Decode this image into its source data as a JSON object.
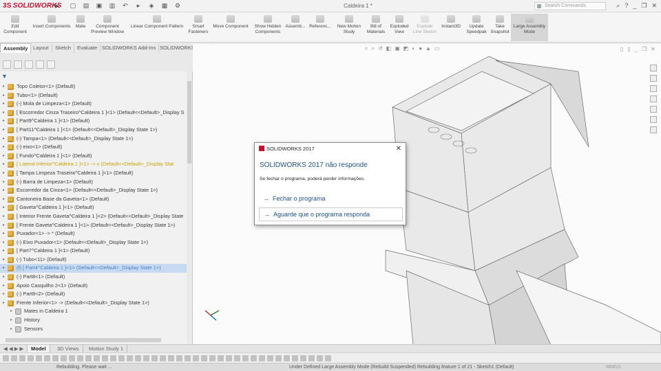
{
  "app": {
    "logo": "SOLIDWORKS",
    "window_title": "Caldeira 1 *",
    "search_placeholder": "Search Commands"
  },
  "ribbon": [
    {
      "label": "Edit\nComponent",
      "icon": "edit-component-icon"
    },
    {
      "label": "Insert Components",
      "icon": "insert-components-icon"
    },
    {
      "label": "Mate",
      "icon": "mate-icon"
    },
    {
      "label": "Component\nPreview Window",
      "icon": "preview-window-icon"
    },
    {
      "label": "Linear Component Pattern",
      "icon": "pattern-icon"
    },
    {
      "label": "Smart\nFasteners",
      "icon": "fasteners-icon"
    },
    {
      "label": "Move Component",
      "icon": "move-component-icon"
    },
    {
      "label": "Show Hidden\nComponents",
      "icon": "show-hidden-icon"
    },
    {
      "label": "Assemb...",
      "icon": "assembly-features-icon"
    },
    {
      "label": "Referenc...",
      "icon": "reference-geometry-icon"
    },
    {
      "label": "New Motion\nStudy",
      "icon": "motion-study-icon"
    },
    {
      "label": "Bill of\nMaterials",
      "icon": "bom-icon"
    },
    {
      "label": "Exploded\nView",
      "icon": "exploded-view-icon"
    },
    {
      "label": "Explode\nLine Sketch",
      "icon": "explode-line-icon"
    },
    {
      "label": "Instant3D",
      "icon": "instant3d-icon"
    },
    {
      "label": "Update\nSpeedpak",
      "icon": "speedpak-icon"
    },
    {
      "label": "Take\nSnapshot",
      "icon": "snapshot-icon"
    },
    {
      "label": "Large Assembly\nMode",
      "icon": "large-assembly-icon"
    }
  ],
  "command_tabs": [
    "Assembly",
    "Layout",
    "Sketch",
    "Evaluate",
    "SOLIDWORKS Add-Ins",
    "SOLIDWORKS MBD"
  ],
  "tree": [
    {
      "text": "Topo Coletor<1> (Default)"
    },
    {
      "text": "Tubo<1> (Default)"
    },
    {
      "text": "(-) Mola de Limpeza<1> (Default)"
    },
    {
      "text": "[ Escorredor Cinza Traseiro^Caldeira 1 ]<1> (Default<<Default>_Display S"
    },
    {
      "text": "[ Part9^Caldeira 1 ]<1> (Default)"
    },
    {
      "text": "[ Part11^Caldeira 1 ]<1> (Default<<Default>_Display State 1>)"
    },
    {
      "text": "(-) Tampa<1> (Default<<Default>_Display State 1>)"
    },
    {
      "text": "(-) eixo<1> (Default)"
    },
    {
      "text": "[ Fundo^Caldeira 1 ]<1> (Default)"
    },
    {
      "text": "[ Lateral Inferior^Caldeira 1 ]<1> -> v (Default<<Default>_Display Stat",
      "state": "warn"
    },
    {
      "text": "[ Tampa Limpeza Traseira^Caldeira 1 ]<1> (Default)"
    },
    {
      "text": "(-) Barra de Limpeza<1> (Default)"
    },
    {
      "text": "Escorredor da Cinza<1> (Default<<Default>_Display State 1>)"
    },
    {
      "text": "Cantoneira Base da Gaveta<1> (Default)"
    },
    {
      "text": "[ Gaveta^Caldeira 1 ]<1> (Default)"
    },
    {
      "text": "[ Interior Frente Gaveta^Caldeira 1 ]<2> (Default<<Default>_Display State"
    },
    {
      "text": "[ Frente Gaveta^Caldeira 1 ]<1> (Default<<Default>_Display State 1>)"
    },
    {
      "text": "Puxador<1> -> * (Default)"
    },
    {
      "text": "(-) Eixo Puxador<1> (Default<<Default>_Display State 1>)"
    },
    {
      "text": "[ Part7^Caldeira 1 ]<1> (Default)"
    },
    {
      "text": "(-) Tubo<11> (Default)"
    },
    {
      "text": "(f) [ Part4^Caldeira 1 ]<1> (Default<<Default>_Display State 1>)",
      "state": "sel"
    },
    {
      "text": "(-) Part8<1> (Default)"
    },
    {
      "text": "Apoio  Casquilho 2<1> (Default)"
    },
    {
      "text": "(-) Part8<2> (Default)"
    },
    {
      "text": "Frente Inferior<1> -> (Default<<Default>_Display State 1>)"
    },
    {
      "text": "Mates in Caldeira 1",
      "sub": true
    },
    {
      "text": "History",
      "sub": true
    },
    {
      "text": "Sensors",
      "sub": true
    }
  ],
  "dialog": {
    "caption": "SOLIDWORKS 2017",
    "title": "SOLIDWORKS 2017 não responde",
    "message": "Se fechar o programa, poderá perder informações.",
    "option_close": "Fechar o programa",
    "option_wait": "Aguarde que o programa responda"
  },
  "bottom_tabs": [
    "Model",
    "3D Views",
    "Motion Study 1"
  ],
  "status": {
    "left": "Rebuilding. Please wait ...",
    "right": "Under Defined   Large Assembly Mode (Rebuild Suspended)   Rebuilding feature 1 of 21 - Sketch1 (Default)",
    "units": "MMGS"
  },
  "colors": {
    "brand": "#c8102e",
    "link": "#1d4f8c",
    "selection": "#c7daf1",
    "warning": "#c7a300"
  }
}
